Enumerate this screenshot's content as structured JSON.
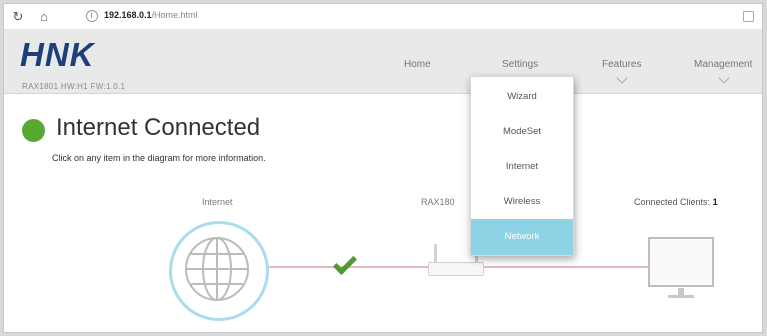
{
  "browser": {
    "address_host": "192.168.0.1",
    "address_path": "/Home.html"
  },
  "header": {
    "logo": "HNK",
    "model_info": "RAX1801 HW:H1 FW:1.0.1",
    "nav": {
      "home": "Home",
      "settings": "Settings",
      "features": "Features",
      "management": "Management"
    }
  },
  "status": {
    "title": "Internet Connected",
    "subtitle": "Click on any item in the diagram for more information.",
    "color": "#58a832"
  },
  "diagram": {
    "internet_label": "Internet",
    "router_label": "RAX180",
    "clients_label": "Connected Clients:",
    "clients_count": "1"
  },
  "settings_menu": {
    "items": [
      "Wizard",
      "ModeSet",
      "Internet",
      "Wireless",
      "Network"
    ],
    "hovered": "Network",
    "hover_color": "#8ed2e6"
  }
}
